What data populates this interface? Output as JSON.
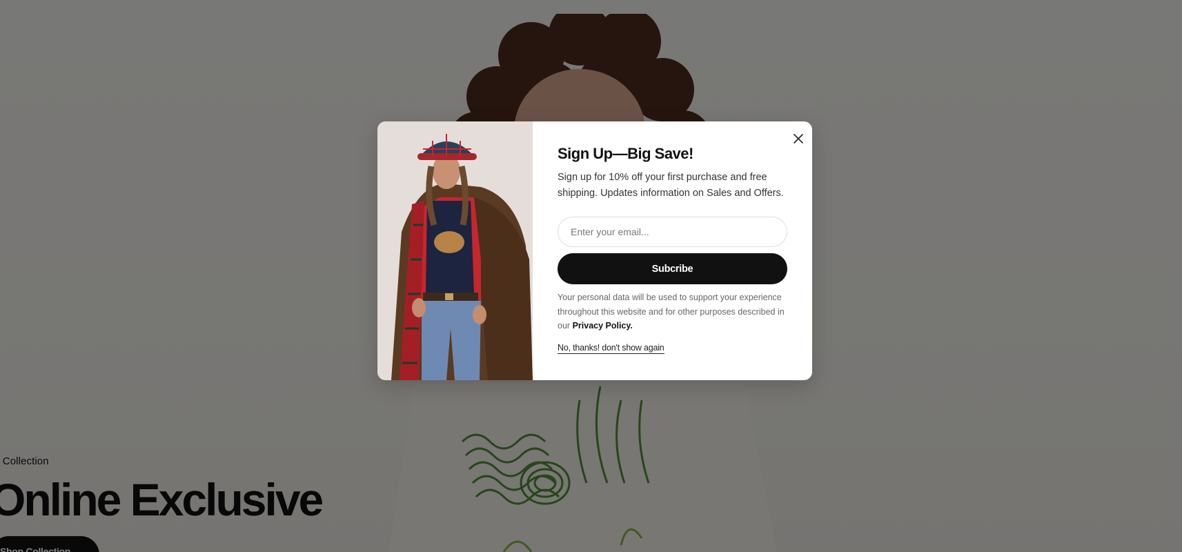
{
  "hero": {
    "eyebrow": "er Collection",
    "title": "Online Exclusive",
    "cta_label": "Shop Collection"
  },
  "modal": {
    "title": "Sign Up—Big Save!",
    "description": "Sign up for 10% off your first purchase and free shipping. Updates information on Sales and Offers.",
    "email_placeholder": "Enter your email...",
    "subscribe_label": "Subcribe",
    "legal_text": "Your personal data will be used to support your experience throughout this website and for other purposes described in our",
    "privacy_link": "Privacy Policy.",
    "dismiss_label": "No, thanks! don't show again",
    "close_icon": "close-icon"
  },
  "colors": {
    "overlay": "rgba(0,0,0,0.5)",
    "primary_button": "#111111",
    "modal_background": "#ffffff"
  }
}
